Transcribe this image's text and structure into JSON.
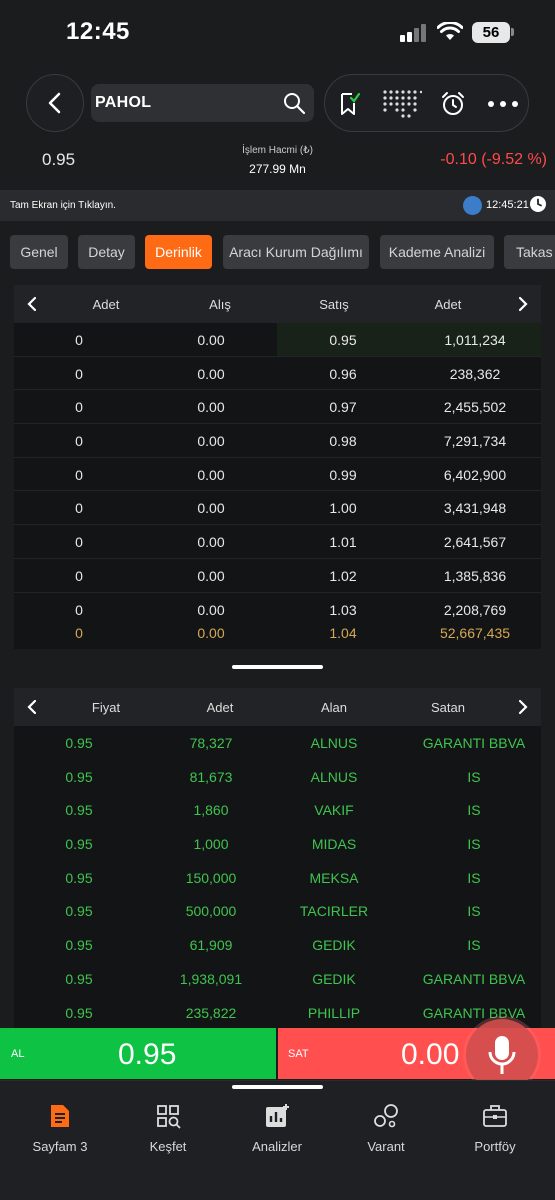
{
  "status_bar": {
    "time": "12:45",
    "battery": "56"
  },
  "header": {
    "search_value": "PAHOL",
    "icons": [
      "back-arrow-icon",
      "search-icon",
      "bookmark-check-icon",
      "dot-matrix-icon",
      "alarm-clock-icon",
      "more-dots-icon"
    ]
  },
  "summary": {
    "last_price": "0.95",
    "volume_label": "İşlem Hacmi (₺)",
    "volume_value": "277.99 Mn",
    "change": "-0.10 (-9.52 %)"
  },
  "info_bar": {
    "fullscreen_text": "Tam Ekran için Tıklayın.",
    "clock": "12:45:21"
  },
  "tabs": [
    {
      "label": "Genel",
      "active": false
    },
    {
      "label": "Detay",
      "active": false
    },
    {
      "label": "Derinlik",
      "active": true
    },
    {
      "label": "Aracı Kurum Dağılımı",
      "active": false
    },
    {
      "label": "Kademe Analizi",
      "active": false
    },
    {
      "label": "Takas Analizi",
      "active": false
    }
  ],
  "depth": {
    "headers": [
      "Adet",
      "Alış",
      "Satış",
      "Adet"
    ],
    "rows": [
      [
        "0",
        "0.00",
        "0.95",
        "1,011,234"
      ],
      [
        "0",
        "0.00",
        "0.96",
        "238,362"
      ],
      [
        "0",
        "0.00",
        "0.97",
        "2,455,502"
      ],
      [
        "0",
        "0.00",
        "0.98",
        "7,291,734"
      ],
      [
        "0",
        "0.00",
        "0.99",
        "6,402,900"
      ],
      [
        "0",
        "0.00",
        "1.00",
        "3,431,948"
      ],
      [
        "0",
        "0.00",
        "1.01",
        "2,641,567"
      ],
      [
        "0",
        "0.00",
        "1.02",
        "1,385,836"
      ]
    ],
    "last_row": [
      "0",
      "0.00",
      "1.03",
      "2,208,769"
    ],
    "total_row": [
      "0",
      "0.00",
      "1.04",
      "52,667,435"
    ]
  },
  "trades": {
    "headers": [
      "Fiyat",
      "Adet",
      "Alan",
      "Satan"
    ],
    "rows": [
      [
        "0.95",
        "78,327",
        "ALNUS",
        "GARANTI BBVA"
      ],
      [
        "0.95",
        "81,673",
        "ALNUS",
        "IS"
      ],
      [
        "0.95",
        "1,860",
        "VAKIF",
        "IS"
      ],
      [
        "0.95",
        "1,000",
        "MIDAS",
        "IS"
      ],
      [
        "0.95",
        "150,000",
        "MEKSA",
        "IS"
      ],
      [
        "0.95",
        "500,000",
        "TACIRLER",
        "IS"
      ],
      [
        "0.95",
        "61,909",
        "GEDIK",
        "IS"
      ],
      [
        "0.95",
        "1,938,091",
        "GEDIK",
        "GARANTI BBVA"
      ],
      [
        "0.95",
        "235,822",
        "PHILLIP",
        "GARANTI BBVA"
      ]
    ]
  },
  "order_bar": {
    "buy_label": "AL",
    "buy_price": "0.95",
    "sell_label": "SAT",
    "sell_price": "0.00"
  },
  "bottom_nav": [
    {
      "label": "Sayfam 3",
      "icon": "document-icon",
      "active": true
    },
    {
      "label": "Keşfet",
      "icon": "grid-search-icon",
      "active": false
    },
    {
      "label": "Analizler",
      "icon": "chart-plus-icon",
      "active": false
    },
    {
      "label": "Varant",
      "icon": "bubbles-icon",
      "active": false
    },
    {
      "label": "Portföy",
      "icon": "briefcase-icon",
      "active": false
    }
  ],
  "colors": {
    "accent": "#ff6a14",
    "buy": "#0ec243",
    "sell": "#ff4f4f",
    "trade_text": "#3fc44f",
    "total_text": "#d6a854"
  }
}
